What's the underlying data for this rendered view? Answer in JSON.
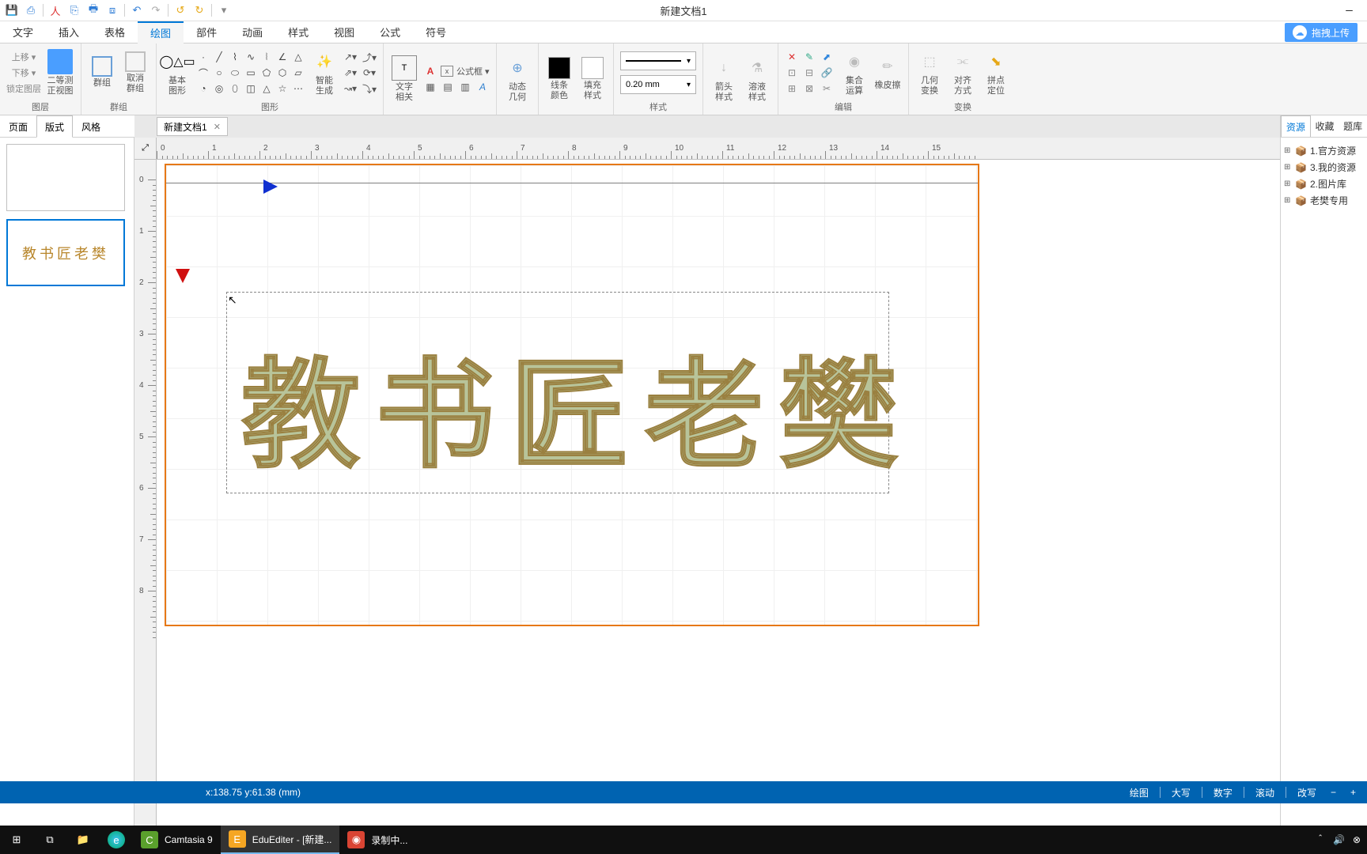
{
  "title": "新建文档1",
  "qat_icons": [
    "save",
    "multisave",
    "pdf",
    "copy",
    "print",
    "screenshot",
    "sep",
    "undo",
    "redo",
    "sep",
    "rotate-left",
    "rotate-right",
    "sep",
    "more"
  ],
  "menu_tabs": [
    "文字",
    "插入",
    "表格",
    "绘图",
    "部件",
    "动画",
    "样式",
    "视图",
    "公式",
    "符号"
  ],
  "active_menu_index": 3,
  "upload_label": "拖拽上传",
  "ribbon": {
    "groups": [
      {
        "label": "图层",
        "items": [
          {
            "label": "上移 ▾"
          },
          {
            "label": "下移 ▾"
          },
          {
            "label": "锁定图层"
          }
        ],
        "lg": [
          {
            "label": "二等测\n正视图"
          }
        ]
      },
      {
        "label": "群组",
        "lg": [
          {
            "label": "群组"
          },
          {
            "label": "取消\n群组"
          }
        ]
      },
      {
        "label": "图形",
        "lg": [
          {
            "label": "基本\n图形"
          }
        ],
        "shapes": true,
        "lg2": [
          {
            "label": "智能\n生成"
          }
        ],
        "arrows": true
      },
      {
        "label": "",
        "lg": [
          {
            "label": "文字\n相关"
          },
          {
            "label": "公式框 ▾"
          }
        ],
        "textrel": true
      },
      {
        "label": "",
        "lg": [
          {
            "label": "动态\n几何"
          }
        ]
      },
      {
        "label": "",
        "lg": [
          {
            "label": "线条\n颜色"
          },
          {
            "label": "填充\n样式"
          }
        ]
      },
      {
        "label": "样式",
        "linestyle": true,
        "linewidth": "0.20 mm"
      },
      {
        "label": "",
        "lg": [
          {
            "label": "箭头\n样式"
          },
          {
            "label": "溶液\n样式"
          }
        ]
      },
      {
        "label": "编辑",
        "edit_icons": true,
        "lg": [
          {
            "label": "集合\n运算"
          },
          {
            "label": "橡皮擦"
          }
        ]
      },
      {
        "label": "变换",
        "lg": [
          {
            "label": "几何\n变换"
          },
          {
            "label": "对齐\n方式"
          },
          {
            "label": "拼点\n定位"
          }
        ]
      }
    ]
  },
  "left_tabs": [
    "页面",
    "版式",
    "风格"
  ],
  "active_left_tab": 1,
  "doc_tab": "新建文档1",
  "slide_thumb_text": "教书匠老樊",
  "canvas_text": "教书匠老樊",
  "right_tabs": [
    "资源",
    "收藏",
    "题库"
  ],
  "active_right_tab": 0,
  "tree_items": [
    "1.官方资源",
    "3.我的资源",
    "2.图片库",
    "老樊专用"
  ],
  "status_coords": "x:138.75  y:61.38  (mm)",
  "status_right": [
    "绘图",
    "大写",
    "数字",
    "滚动",
    "改写"
  ],
  "taskbar": {
    "items": [
      {
        "icon": "⊞",
        "color": "#fff"
      },
      {
        "icon": "⧉",
        "color": "#fff"
      },
      {
        "icon": "📁",
        "color": "#f7d774"
      },
      {
        "icon": "e",
        "color": "#3cc4f5",
        "round": true
      },
      {
        "icon": "C",
        "color": "#fff",
        "bg": "#5aa02c",
        "label": "Camtasia 9"
      },
      {
        "icon": "E",
        "color": "#fff",
        "bg": "#f5a623",
        "label": "EduEditer - [新建...",
        "active": true
      },
      {
        "icon": "◉",
        "color": "#fff",
        "bg": "#d94433",
        "label": "录制中..."
      }
    ],
    "tray": [
      "＾",
      "🔊",
      "⊗"
    ]
  },
  "ruler_h": [
    "0",
    "1",
    "2",
    "3",
    "4",
    "5",
    "6",
    "7",
    "8",
    "9",
    "10",
    "11",
    "12",
    "13",
    "14",
    "15"
  ],
  "ruler_v": [
    "0",
    "1",
    "2",
    "3",
    "4",
    "5",
    "6",
    "7",
    "8"
  ]
}
